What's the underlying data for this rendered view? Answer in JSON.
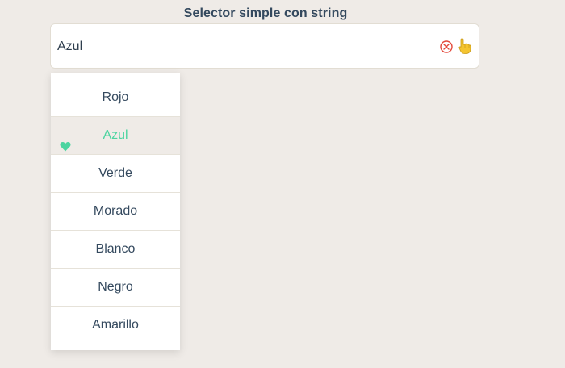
{
  "title": "Selector simple con string",
  "select": {
    "value": "Azul"
  },
  "dropdown": {
    "options": [
      "Rojo",
      "Azul",
      "Verde",
      "Morado",
      "Blanco",
      "Negro",
      "Amarillo"
    ],
    "selected": "Azul"
  },
  "colors": {
    "background": "#efebe7",
    "selected_text": "#4cd4a0",
    "clear_icon": "#e3483a",
    "pointer_icon": "#f4c430"
  },
  "icons": {
    "clear": "clear-icon",
    "pointer": "pointing-hand-icon",
    "selected_marker": "heart-icon"
  }
}
